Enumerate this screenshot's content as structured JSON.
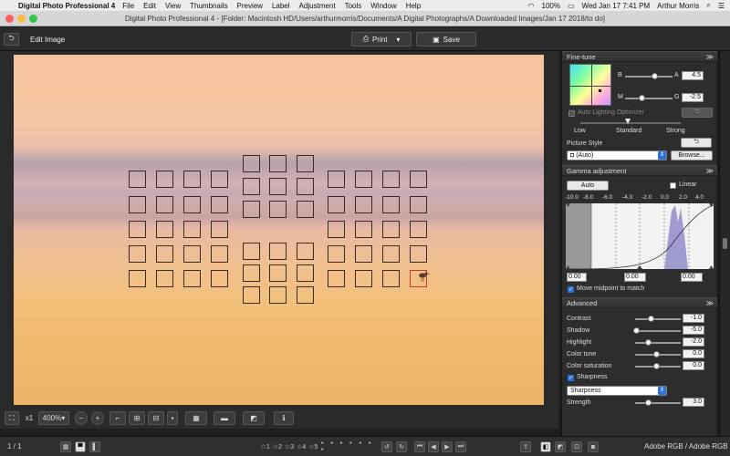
{
  "menubar": {
    "app_name": "Digital Photo Professional 4",
    "items": [
      "File",
      "Edit",
      "View",
      "Thumbnails",
      "Preview",
      "Label",
      "Adjustment",
      "Tools",
      "Window",
      "Help"
    ],
    "battery": "100%",
    "datetime": "Wed Jan 17  7:41 PM",
    "user": "Arthur Morris"
  },
  "window": {
    "title": "Digital Photo Professional 4 - [Folder: Macintosh HD/Users/arthurmorris/Documents/A Digital Photographs/A Downloaded Images/Jan 17 2018/to do]"
  },
  "toolbar": {
    "back_label": "⮌",
    "edit_image_label": "Edit Image",
    "print_label": "Print",
    "save_label": "Save"
  },
  "image_tools": {
    "fit_label": "⛶",
    "x1_label": "x1",
    "zoom_value": "400%"
  },
  "statusbar": {
    "page_indicator": "1 / 1",
    "stars": [
      "☆1",
      "☆2",
      "☆3",
      "☆4",
      "☆5"
    ],
    "color_space": "Adobe RGB / Adobe RGB"
  },
  "fine_tune": {
    "header": "Fine-tune",
    "b_label": "B",
    "a_label": "A",
    "a_value": "4.5",
    "m_label": "M",
    "g_label": "G",
    "g_value": "-2.5",
    "alo_label": "Auto Lighting Optimizer",
    "alo_low": "Low",
    "alo_standard": "Standard",
    "alo_strong": "Strong",
    "picture_style_label": "Picture Style",
    "picture_style_value": "(Auto)",
    "browse_label": "Browse..."
  },
  "gamma": {
    "header": "Gamma adjustment",
    "auto_label": "Auto",
    "linear_label": "Linear",
    "scale": [
      "-10.0",
      "-8.0",
      "-6.0",
      "-4.0",
      "-2.0",
      "0.0",
      "2.0",
      "4.0"
    ],
    "left_value": "0.00",
    "mid_value": "0.00",
    "right_value": "0.00",
    "midpoint_label": "Move midpoint to match"
  },
  "advanced": {
    "header": "Advanced",
    "contrast_label": "Contrast",
    "contrast_value": "-1.0",
    "shadow_label": "Shadow",
    "shadow_value": "-5.0",
    "highlight_label": "Highlight",
    "highlight_value": "-2.0",
    "color_tone_label": "Color tone",
    "color_tone_value": "0.0",
    "color_saturation_label": "Color saturation",
    "color_saturation_value": "0.0",
    "sharpness_check_label": "Sharpness",
    "sharpness_select": "Sharpness",
    "strength_label": "Strength",
    "strength_value": "3.0"
  },
  "colors": {
    "accent": "#2c73d8",
    "af_point_active": "#c43a2a"
  }
}
